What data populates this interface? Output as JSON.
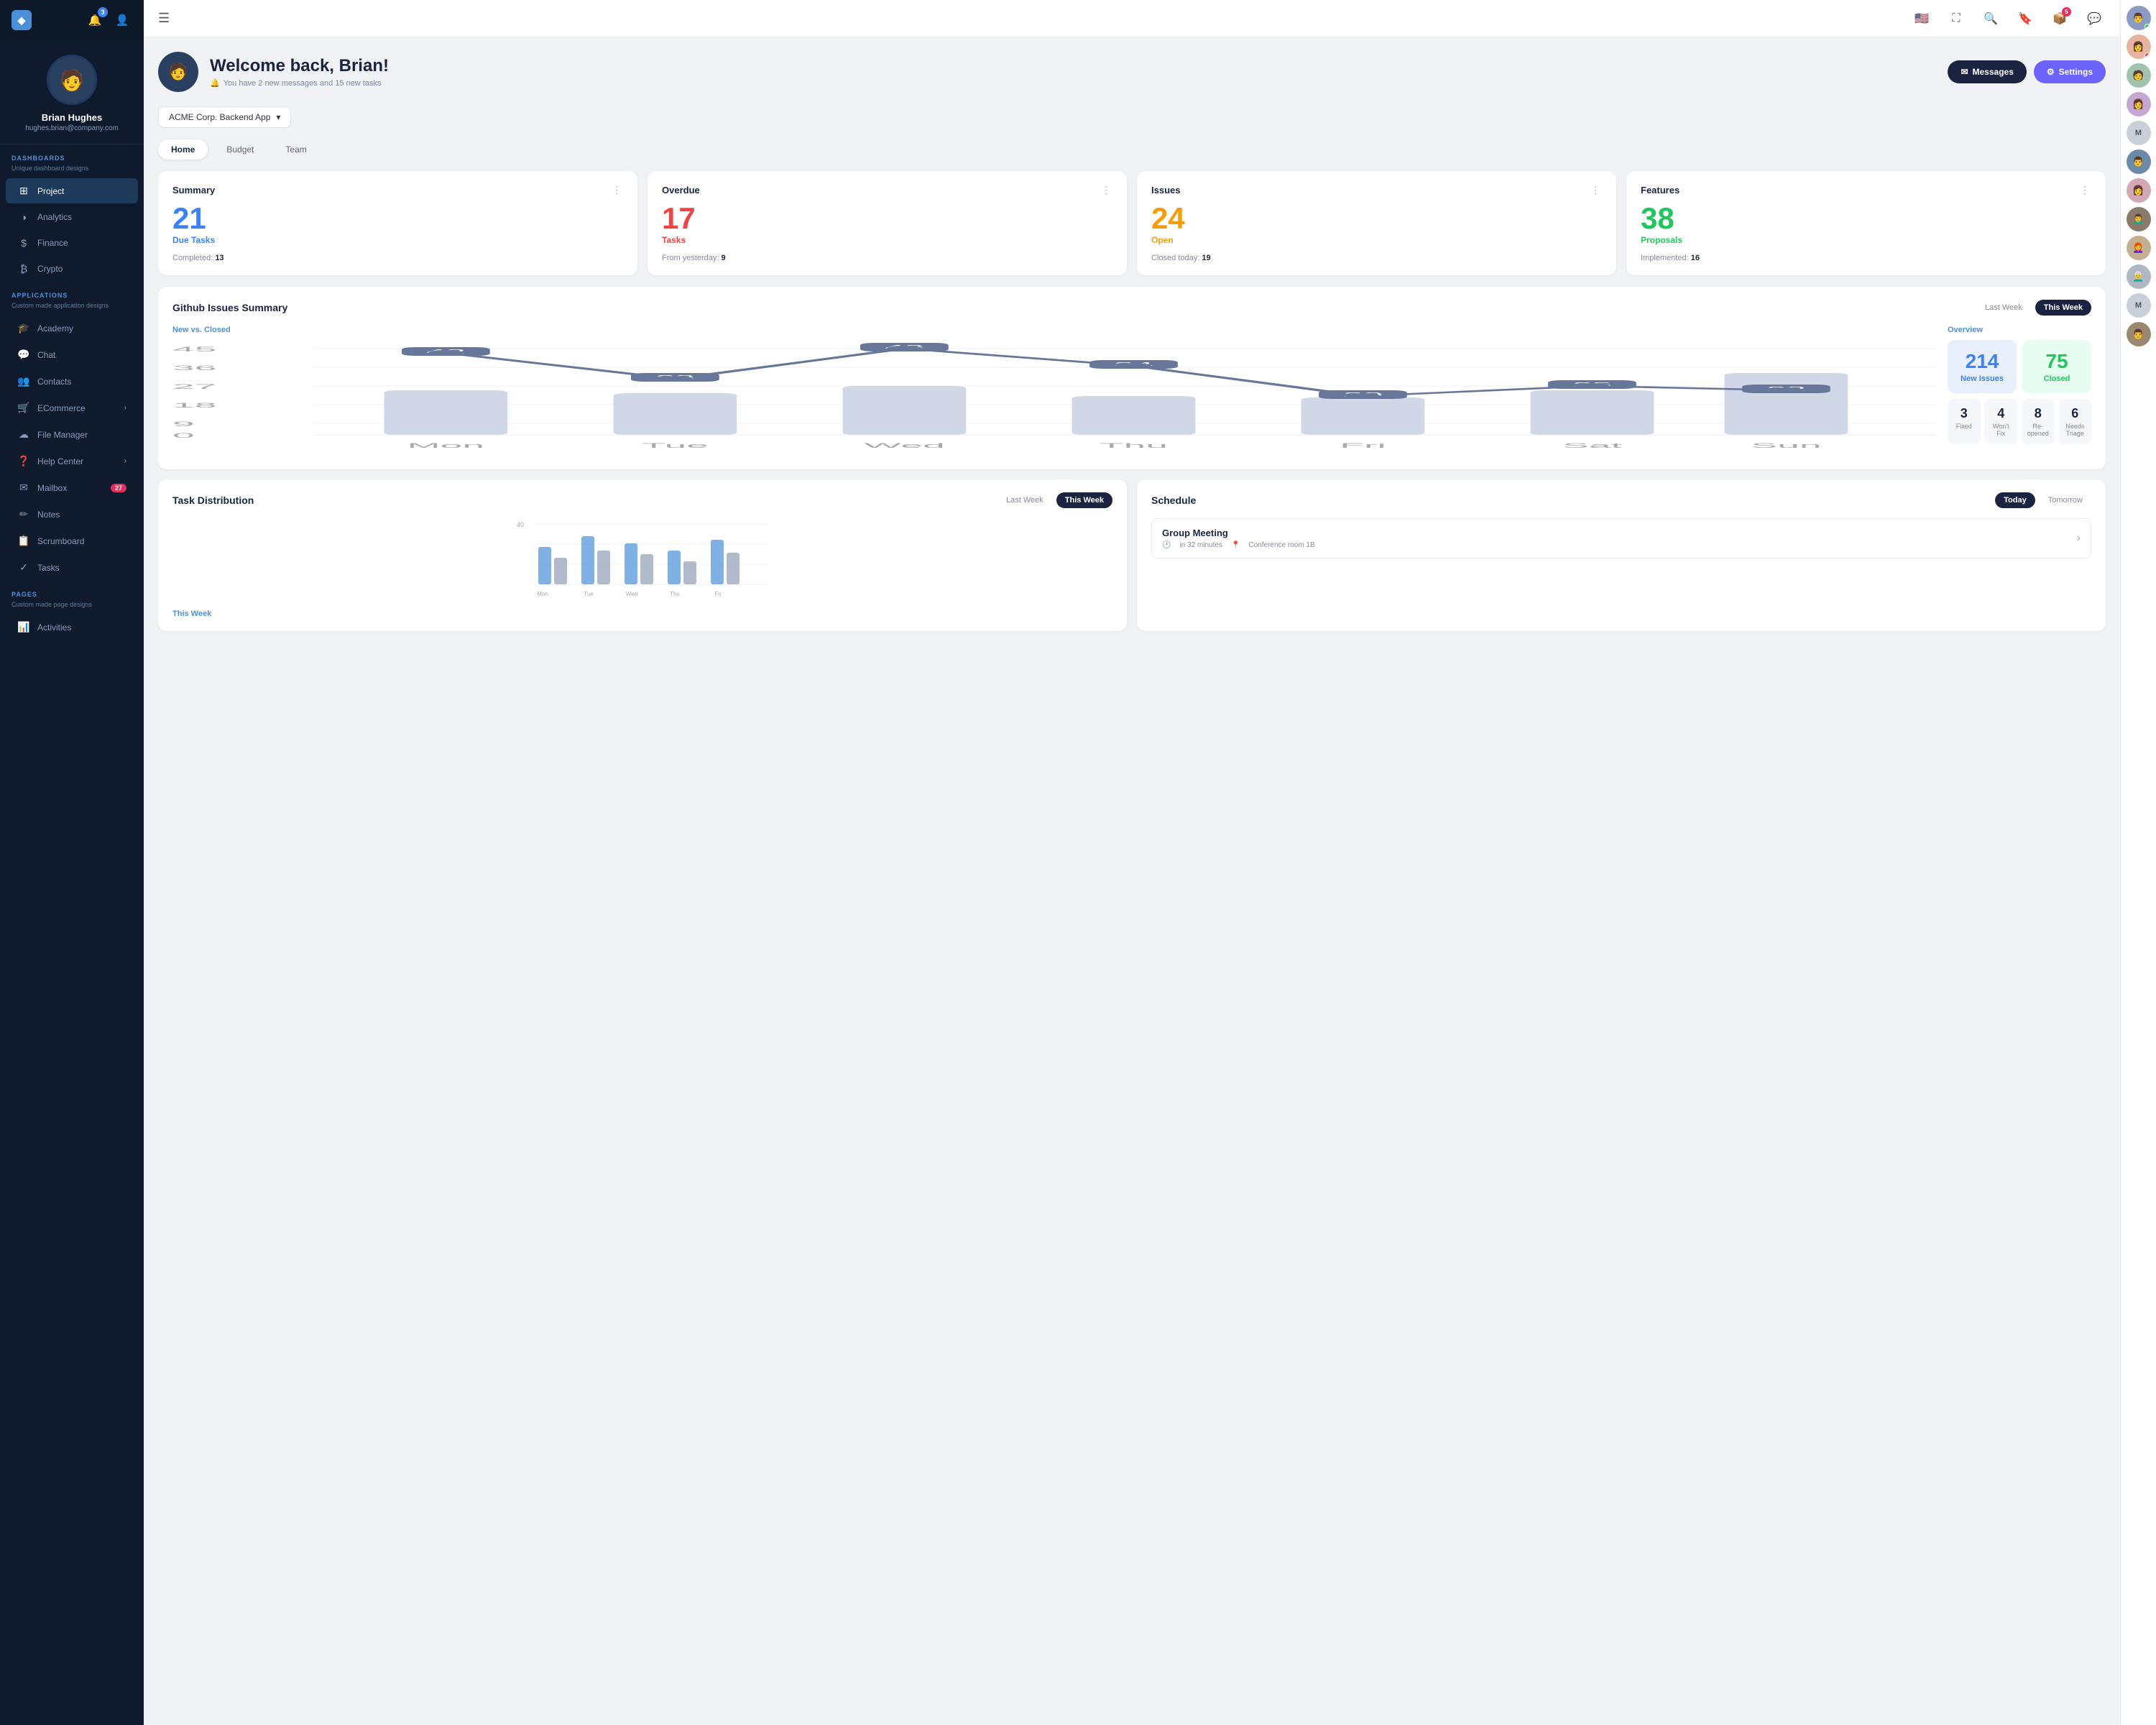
{
  "sidebar": {
    "logo": "◆",
    "user": {
      "name": "Brian Hughes",
      "email": "hughes.brian@company.com",
      "avatar": "👤"
    },
    "notifications_badge": "3",
    "dashboards_label": "DASHBOARDS",
    "dashboards_sub": "Unique dashboard designs",
    "dash_items": [
      {
        "id": "project",
        "icon": "☰",
        "label": "Project",
        "active": true
      },
      {
        "id": "analytics",
        "icon": "◑",
        "label": "Analytics"
      },
      {
        "id": "finance",
        "icon": "$",
        "label": "Finance"
      },
      {
        "id": "crypto",
        "icon": "₿",
        "label": "Crypto"
      }
    ],
    "applications_label": "APPLICATIONS",
    "applications_sub": "Custom made application designs",
    "app_items": [
      {
        "id": "academy",
        "icon": "🎓",
        "label": "Academy"
      },
      {
        "id": "chat",
        "icon": "💬",
        "label": "Chat"
      },
      {
        "id": "contacts",
        "icon": "👥",
        "label": "Contacts"
      },
      {
        "id": "ecommerce",
        "icon": "🛒",
        "label": "ECommerce",
        "chevron": true
      },
      {
        "id": "filemanager",
        "icon": "☁",
        "label": "File Manager"
      },
      {
        "id": "helpcenter",
        "icon": "❓",
        "label": "Help Center",
        "chevron": true
      },
      {
        "id": "mailbox",
        "icon": "✉",
        "label": "Mailbox",
        "badge": "27"
      },
      {
        "id": "notes",
        "icon": "✏",
        "label": "Notes"
      },
      {
        "id": "scrumboard",
        "icon": "📋",
        "label": "Scrumboard"
      },
      {
        "id": "tasks",
        "icon": "✓",
        "label": "Tasks"
      }
    ],
    "pages_label": "PAGES",
    "pages_sub": "Custom made page designs",
    "page_items": [
      {
        "id": "activities",
        "icon": "📊",
        "label": "Activities"
      }
    ]
  },
  "topnav": {
    "menu_icon": "☰",
    "icons": [
      "🔍",
      "🔖",
      "📦",
      "💬"
    ],
    "inbox_badge": "5"
  },
  "right_sidebar": {
    "avatars": [
      "👨",
      "👩",
      "🧑",
      "👩",
      "M",
      "👨",
      "👩",
      "👨‍🦱",
      "👩‍🦰",
      "👨‍🦳",
      "M",
      "👨"
    ]
  },
  "header": {
    "title": "Welcome back, Brian!",
    "subtitle": "You have 2 new messages and 15 new tasks",
    "messages_btn": "Messages",
    "settings_btn": "Settings"
  },
  "project_selector": {
    "label": "ACME Corp. Backend App"
  },
  "tabs": [
    "Home",
    "Budget",
    "Team"
  ],
  "active_tab": "Home",
  "cards": [
    {
      "title": "Summary",
      "number": "21",
      "number_color": "blue",
      "label": "Due Tasks",
      "label_color": "blue",
      "footer_key": "Completed:",
      "footer_val": "13"
    },
    {
      "title": "Overdue",
      "number": "17",
      "number_color": "red",
      "label": "Tasks",
      "label_color": "red",
      "footer_key": "From yesterday:",
      "footer_val": "9"
    },
    {
      "title": "Issues",
      "number": "24",
      "number_color": "orange",
      "label": "Open",
      "label_color": "orange",
      "footer_key": "Closed today:",
      "footer_val": "19"
    },
    {
      "title": "Features",
      "number": "38",
      "number_color": "green",
      "label": "Proposals",
      "label_color": "green",
      "footer_key": "Implemented:",
      "footer_val": "16"
    }
  ],
  "github_issues": {
    "title": "Github Issues Summary",
    "last_week_btn": "Last Week",
    "this_week_btn": "This Week",
    "chart": {
      "subtitle": "New vs. Closed",
      "days": [
        "Mon",
        "Tue",
        "Wed",
        "Thu",
        "Fri",
        "Sat",
        "Sun"
      ],
      "line_values": [
        42,
        28,
        43,
        34,
        20,
        25,
        22
      ],
      "bar_values": [
        28,
        26,
        30,
        24,
        22,
        28,
        38
      ],
      "y_labels": [
        "45",
        "36",
        "27",
        "18",
        "9",
        "0"
      ]
    },
    "overview": {
      "label": "Overview",
      "new_issues": "214",
      "new_issues_label": "New Issues",
      "closed": "75",
      "closed_label": "Closed",
      "mini": [
        {
          "num": "3",
          "label": "Fixed"
        },
        {
          "num": "4",
          "label": "Won't Fix"
        },
        {
          "num": "8",
          "label": "Re-opened"
        },
        {
          "num": "6",
          "label": "Needs Triage"
        }
      ]
    }
  },
  "task_distribution": {
    "title": "Task Distribution",
    "last_week_btn": "Last Week",
    "this_week_btn": "This Week",
    "this_week_label": "This Week",
    "chart_max": 40
  },
  "schedule": {
    "title": "Schedule",
    "today_btn": "Today",
    "tomorrow_btn": "Tomorrow",
    "items": [
      {
        "title": "Group Meeting",
        "time": "in 32 minutes",
        "location": "Conference room 1B"
      }
    ]
  }
}
